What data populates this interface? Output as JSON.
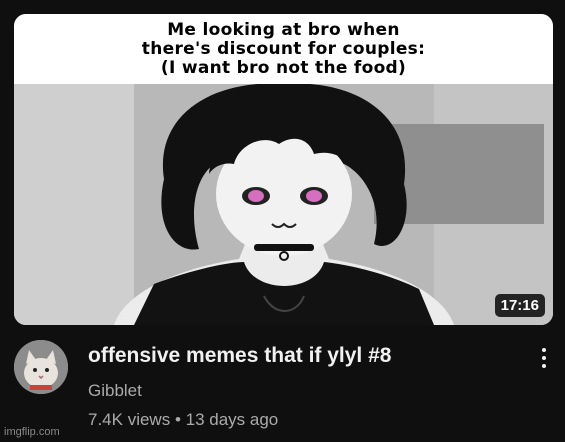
{
  "thumbnail": {
    "caption": [
      "Me looking at bro when",
      "there's discount for couples:",
      "(I want bro not the food)"
    ],
    "duration": "17:16"
  },
  "video": {
    "title": "offensive memes that if ylyl #8",
    "channel": "Gibblet",
    "views": "7.4K views",
    "separator": "•",
    "age": "13 days ago"
  },
  "watermark": "imgflip.com",
  "icons": {
    "avatar": "cat-avatar-icon",
    "menu": "more-vert-icon"
  },
  "colors": {
    "background": "#0f0f0f",
    "title": "#f1f1f1",
    "secondary_text": "#aaaaaa"
  }
}
